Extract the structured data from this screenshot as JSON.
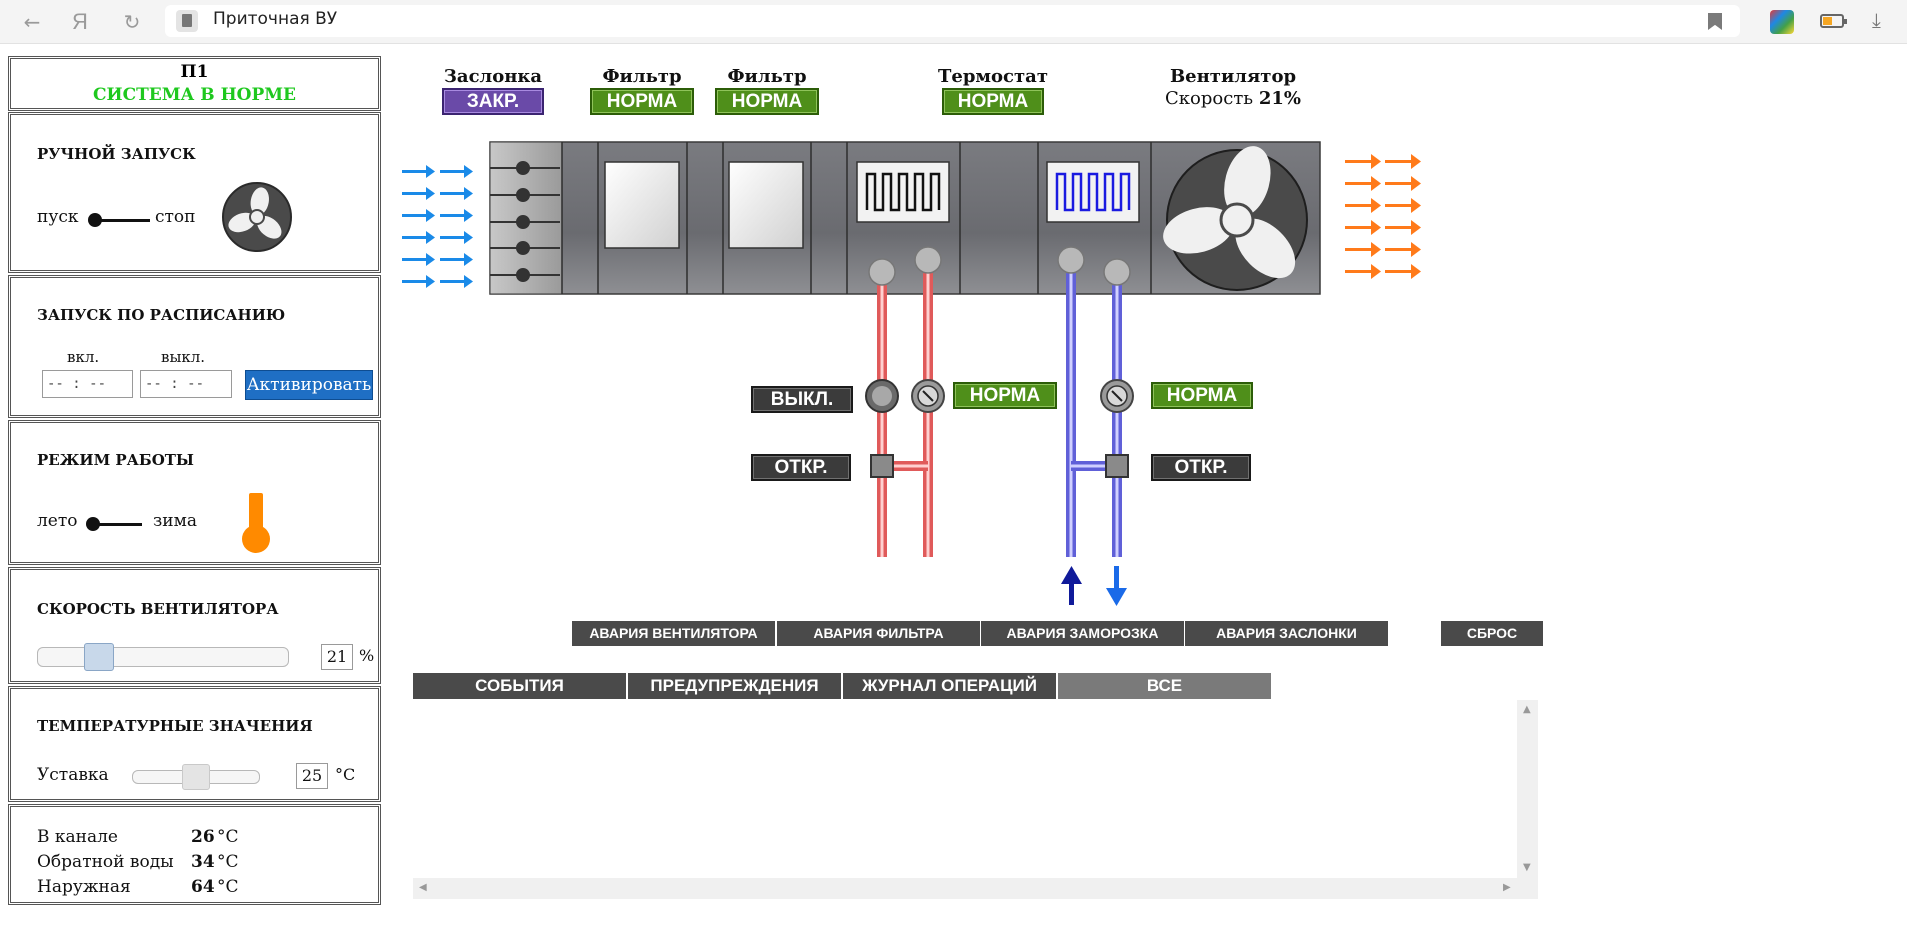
{
  "browser": {
    "back_icon": "back-arrow-icon",
    "tab_title": "Приточная ВУ",
    "yandex_label": "Я",
    "reload_icon": "reload-icon"
  },
  "left_panel": {
    "system": {
      "name": "П1",
      "status": "СИСТЕМА В НОРМЕ",
      "status_color": "#1ec81e"
    },
    "manual_start": {
      "title": "РУЧНОЙ ЗАПУСК",
      "on_label": "пуск",
      "off_label": "стоп",
      "state": "пуск"
    },
    "schedule": {
      "title": "ЗАПУСК ПО РАСПИСАНИЮ",
      "on_label": "вкл.",
      "off_label": "выкл.",
      "on_value": "-- : --",
      "off_value": "-- : --",
      "activate_label": "Активировать"
    },
    "mode": {
      "title": "РЕЖИМ РАБОТЫ",
      "summer_label": "лето",
      "winter_label": "зима",
      "state": "лето"
    },
    "fan_speed": {
      "title": "СКОРОСТЬ ВЕНТИЛЯТОРА",
      "value": "21",
      "unit": "%",
      "slider_fraction": 0.21
    },
    "temperatures": {
      "title": "ТЕМПЕРАТУРНЫЕ ЗНАЧЕНИЯ",
      "setpoint_label": "Уставка",
      "setpoint_value": "25",
      "unit": "°C",
      "slider_fraction": 0.5
    },
    "readings": [
      {
        "label": "В канале",
        "value": "26",
        "unit": "°C"
      },
      {
        "label": "Обратной воды",
        "value": "34",
        "unit": "°C"
      },
      {
        "label": "Наружная",
        "value": "64",
        "unit": "°C"
      }
    ]
  },
  "scheme": {
    "damper": {
      "title": "Заслонка",
      "state": "ЗАКР."
    },
    "filter1": {
      "title": "Фильтр",
      "state": "НОРМА"
    },
    "filter2": {
      "title": "Фильтр",
      "state": "НОРМА"
    },
    "thermostat": {
      "title": "Термостат",
      "state": "НОРМА"
    },
    "fan": {
      "title": "Вентилятор",
      "speed_label": "Скорость",
      "speed_value": "21%"
    },
    "heater_pump": {
      "state": "ВЫКЛ."
    },
    "heater_pressure": {
      "state": "НОРМА"
    },
    "heater_valve": {
      "state": "ОТКР."
    },
    "cooler_pressure": {
      "state": "НОРМА"
    },
    "cooler_valve": {
      "state": "ОТКР."
    },
    "colors": {
      "ok": "#4f8f1a",
      "closed": "#6a4aa8",
      "neutral": "#3b3b3b",
      "hot": "#e05a5a",
      "cold": "#6060d8",
      "intake_arrow": "#1a8ae8",
      "exhaust_arrow": "#ff7a1a"
    }
  },
  "alarms": {
    "fan": "АВАРИЯ ВЕНТИЛЯТОРА",
    "filter": "АВАРИЯ ФИЛЬТРА",
    "frost": "АВАРИЯ ЗАМОРОЗКА",
    "damper": "АВАРИЯ ЗАСЛОНКИ",
    "reset": "СБРОС"
  },
  "log_tabs": {
    "events": "СОБЫТИЯ",
    "warnings": "ПРЕДУПРЕЖДЕНИЯ",
    "operations": "ЖУРНАЛ ОПЕРАЦИЙ",
    "all": "ВСЕ",
    "active": "ВСЕ"
  }
}
